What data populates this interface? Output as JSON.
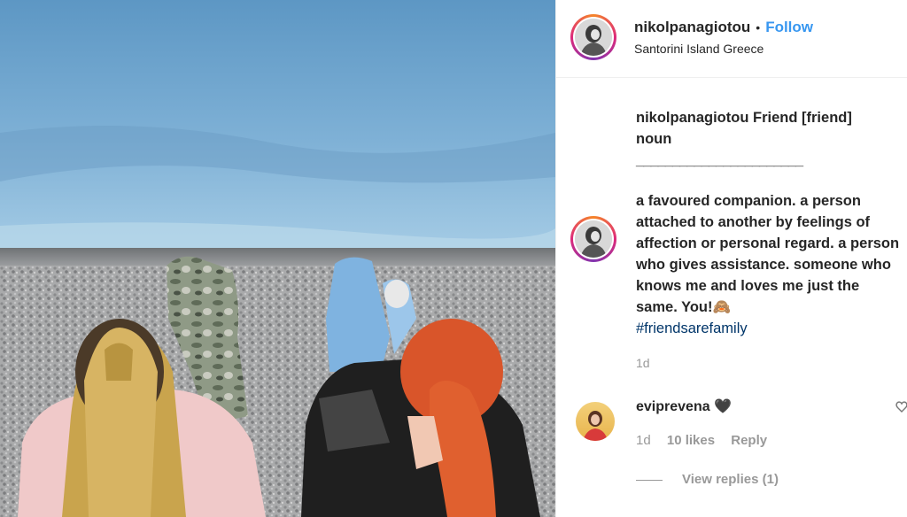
{
  "post": {
    "username": "nikolpanagiotou",
    "separator": "•",
    "follow_label": "Follow",
    "location": "Santorini Island Greece"
  },
  "caption": {
    "username": "nikolpanagiotou",
    "headline": "Friend [friend]",
    "pos": "noun",
    "rule": "_______________________",
    "body": "a favoured companion. a person attached to another by feelings of affection or personal regard. a person who gives assistance. someone who knows me and loves me just the same. You!🙈",
    "hashtag": "#friendsarefamily",
    "time": "1d"
  },
  "comment": {
    "username": "eviprevena",
    "text": "🖤",
    "time": "1d",
    "likes": "10 likes",
    "reply_label": "Reply",
    "view_replies": "View replies (1)"
  },
  "colors": {
    "link_blue": "#3897f0",
    "hashtag": "#003569",
    "muted": "#999999",
    "text": "#262626"
  },
  "icons": {
    "comment_like": "heart-outline-icon"
  }
}
